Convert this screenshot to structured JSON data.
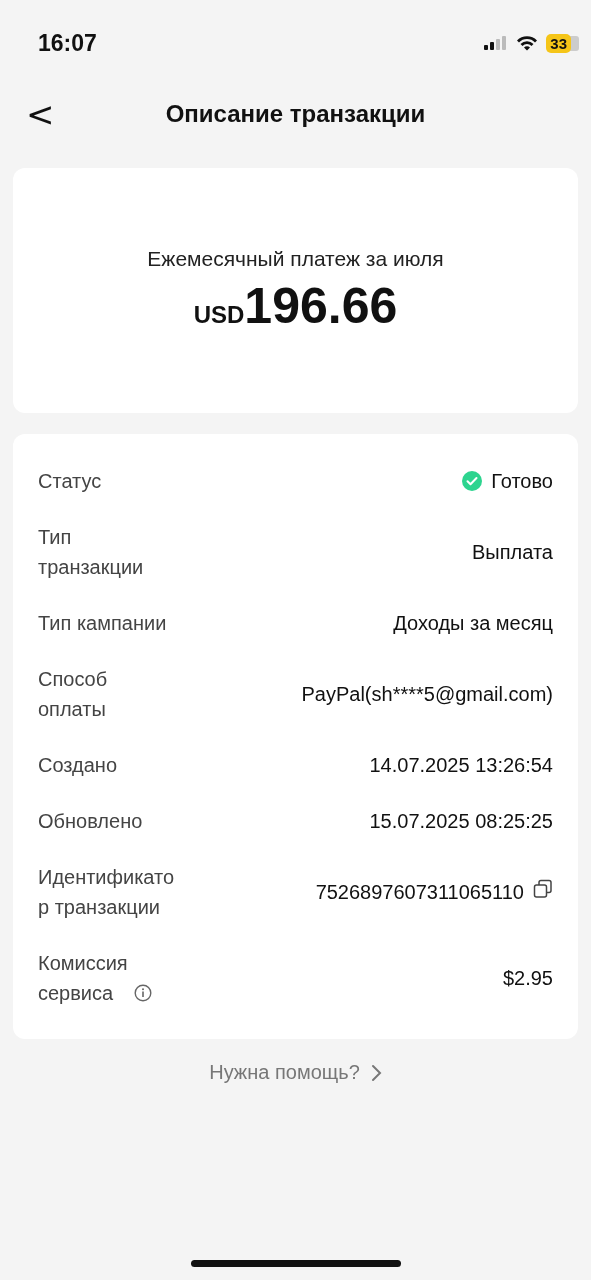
{
  "status_bar": {
    "time": "16:07",
    "battery": "33"
  },
  "header": {
    "back": "<",
    "title": "Описание транзакции"
  },
  "summary": {
    "caption": "Ежемесячный платеж за июля",
    "currency": "USD",
    "amount": "196.66"
  },
  "details": [
    {
      "kind": "status",
      "label": "Статус",
      "value": "Готово",
      "color": "#2dd48f"
    },
    {
      "kind": "text",
      "label": "Тип\nтранзакции",
      "value": "Выплата"
    },
    {
      "kind": "text",
      "label": "Тип кампании",
      "value": "Доходы за месяц"
    },
    {
      "kind": "text",
      "label": "Способ\nоплаты",
      "value": "PayPal(sh****5@gmail.com)"
    },
    {
      "kind": "text",
      "label": "Создано",
      "value": "14.07.2025 13:26:54"
    },
    {
      "kind": "text",
      "label": "Обновлено",
      "value": "15.07.2025 08:25:25"
    },
    {
      "kind": "copy",
      "label": "Идентификато\nр транзакции",
      "value": "7526897607311065110"
    },
    {
      "kind": "info",
      "label": "Комиссия\nсервиса",
      "value": "$2.95"
    }
  ],
  "help_link": "Нужна помощь?"
}
